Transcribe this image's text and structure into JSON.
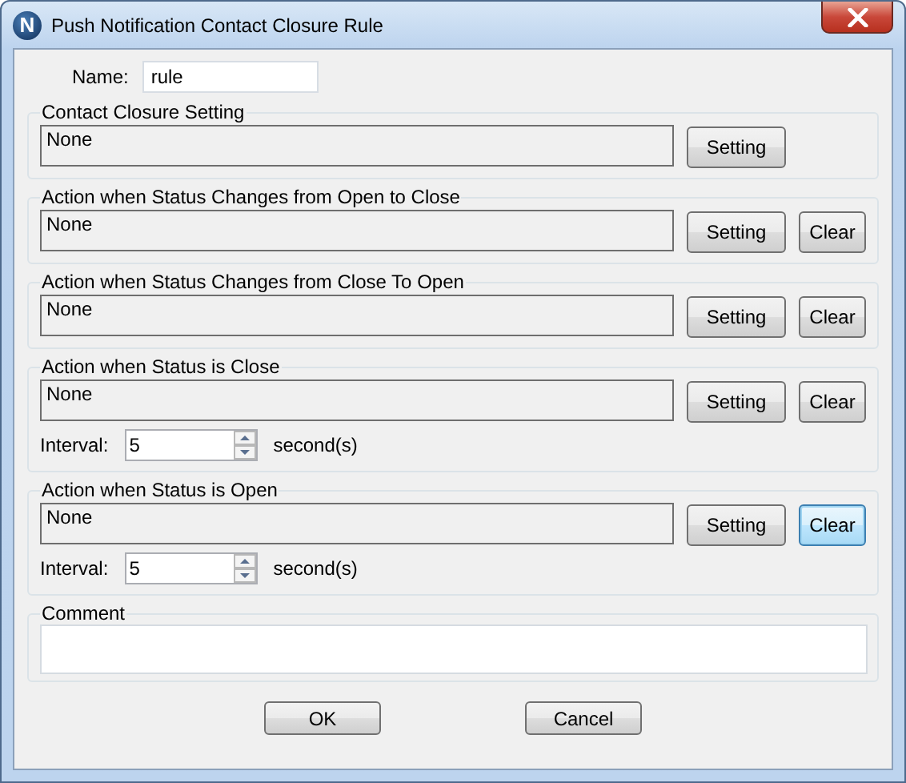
{
  "window": {
    "title": "Push Notification Contact Closure Rule",
    "icon_letter": "N"
  },
  "name_field": {
    "label": "Name:",
    "value": "rule"
  },
  "sections": [
    {
      "title": "Contact Closure Setting",
      "value": "None",
      "setting_button": "Setting"
    },
    {
      "title": "Action when Status Changes from Open to Close",
      "value": "None",
      "setting_button": "Setting",
      "clear_button": {
        "label": "Clear",
        "focused": false
      }
    },
    {
      "title": "Action when Status Changes from Close To Open",
      "value": "None",
      "setting_button": "Setting",
      "clear_button": {
        "label": "Clear",
        "focused": false
      }
    },
    {
      "title": "Action when Status is Close",
      "value": "None",
      "setting_button": "Setting",
      "clear_button": {
        "label": "Clear",
        "focused": false
      },
      "interval": {
        "label": "Interval:",
        "value": "5",
        "unit": "second(s)"
      }
    },
    {
      "title": "Action when Status is Open",
      "value": "None",
      "setting_button": "Setting",
      "clear_button": {
        "label": "Clear",
        "focused": true
      },
      "interval": {
        "label": "Interval:",
        "value": "5",
        "unit": "second(s)"
      }
    }
  ],
  "comment": {
    "label": "Comment"
  },
  "buttons": [
    "OK",
    "Cancel"
  ]
}
